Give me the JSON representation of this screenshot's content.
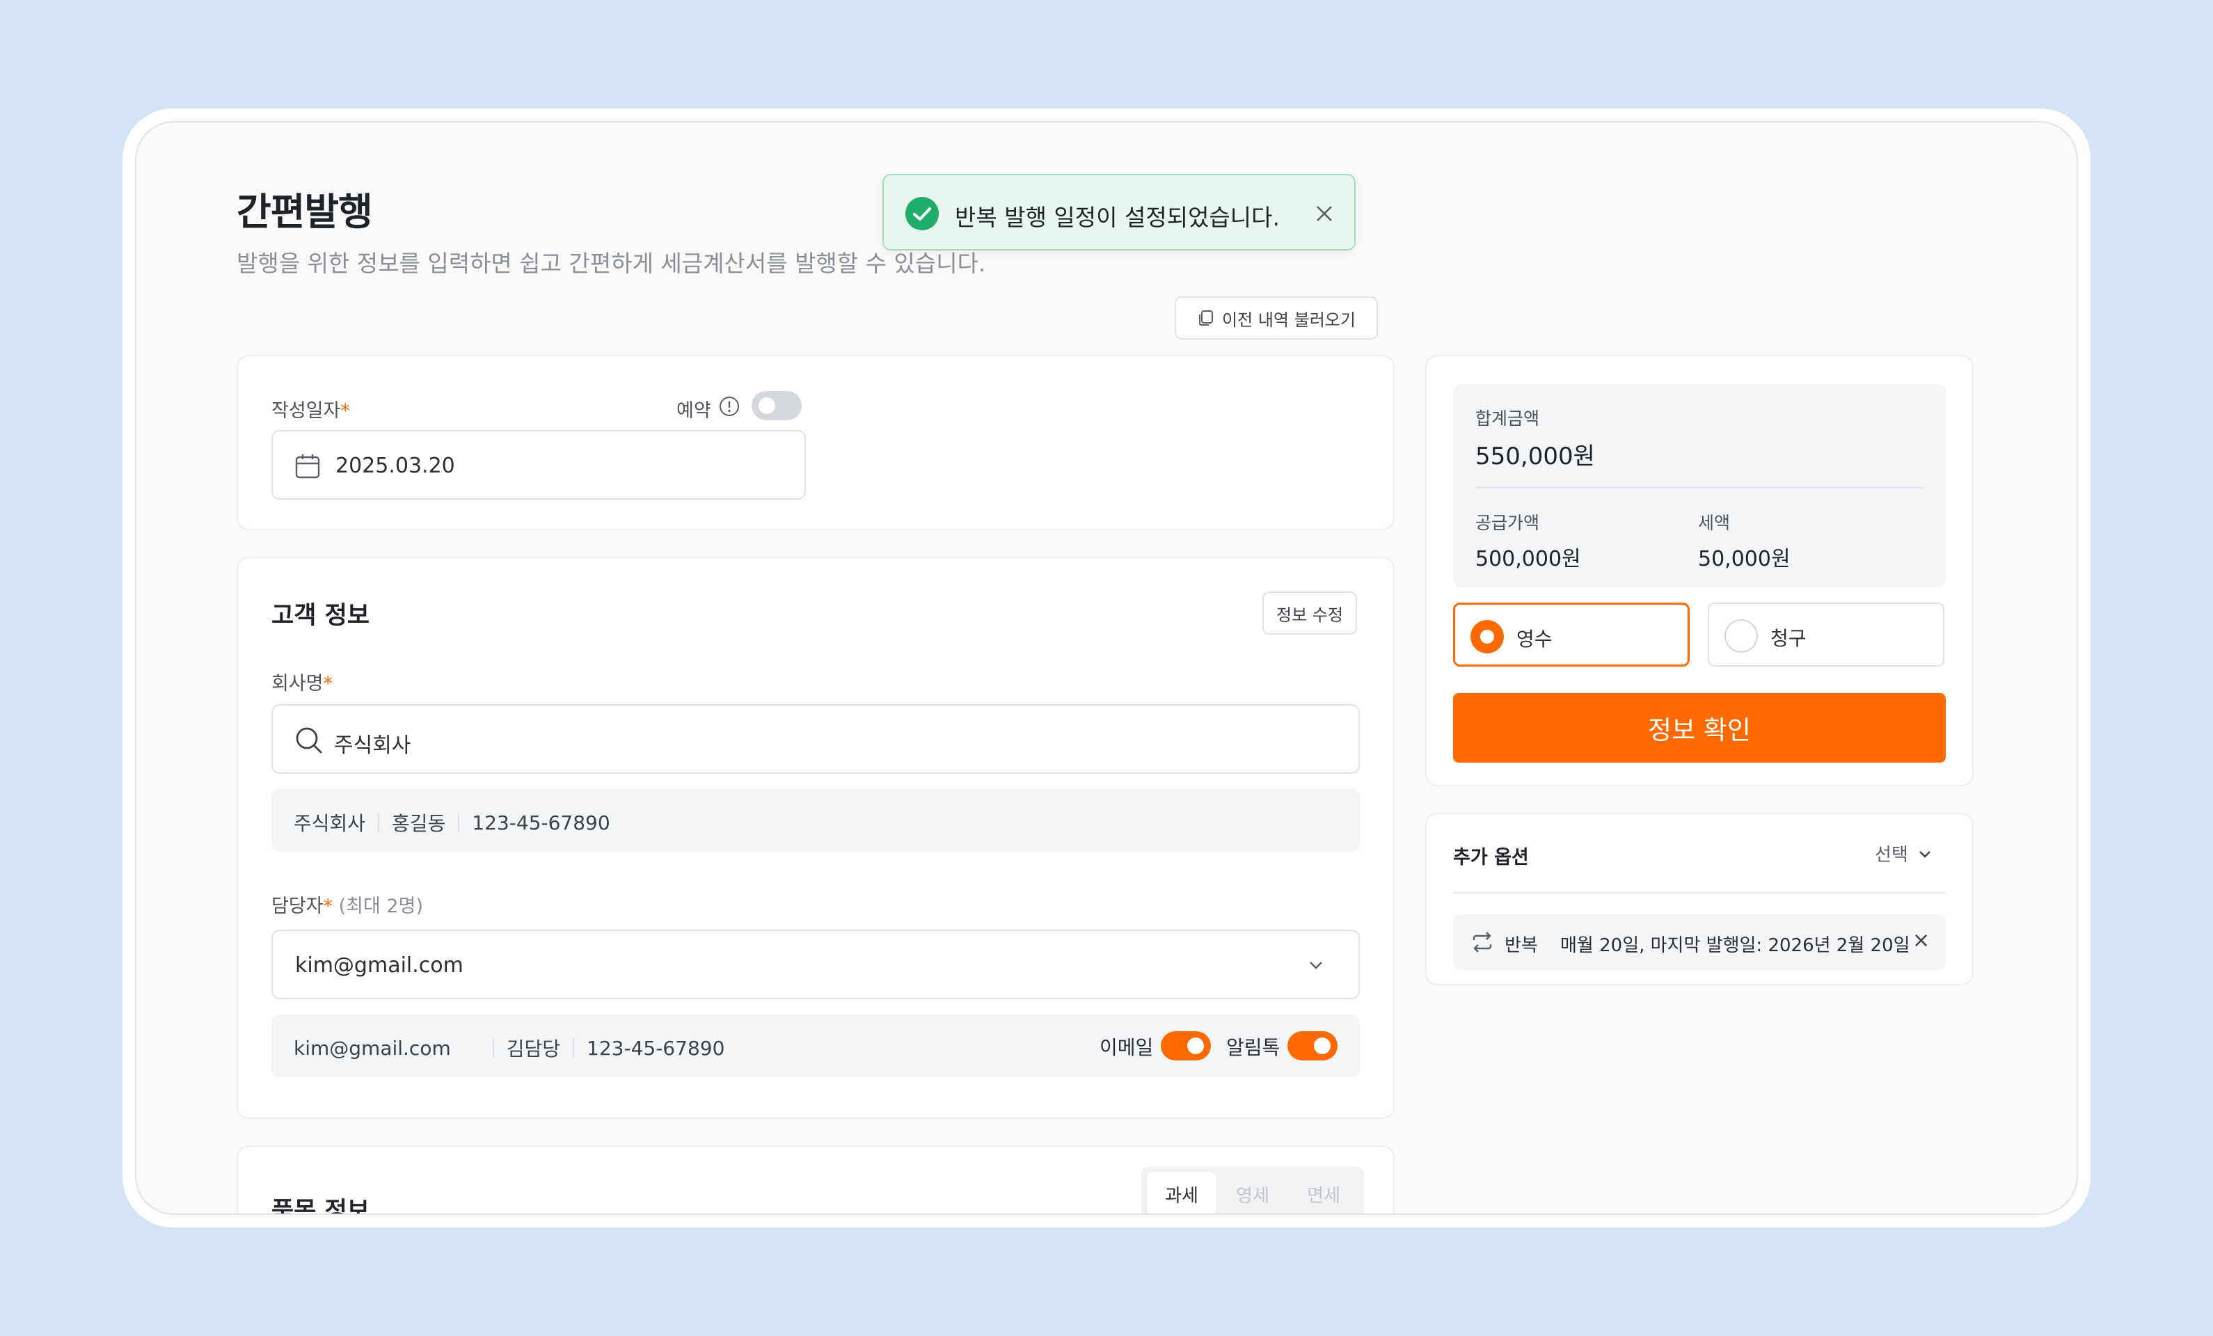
{
  "page": {
    "title": "간편발행",
    "subtitle": "발행을 위한 정보를 입력하면 쉽고 간편하게 세금계산서를 발행할 수 있습니다.",
    "load_history_label": "이전 내역 불러오기"
  },
  "toast": {
    "message": "반복 발행 일정이 설정되었습니다."
  },
  "date_section": {
    "label": "작성일자",
    "required_mark": "*",
    "reserve_label": "예약",
    "reserve_on": false,
    "date_value": "2025.03.20"
  },
  "customer": {
    "title": "고객 정보",
    "edit_label": "정보 수정",
    "company_label": "회사명",
    "required_mark": "*",
    "company_value": "주식회사",
    "summary": {
      "company": "주식회사",
      "representative": "홍길동",
      "business_no": "123-45-67890"
    },
    "manager_label": "담당자",
    "manager_hint": "(최대 2명)",
    "manager_value": "kim@gmail.com",
    "manager_info": {
      "email": "kim@gmail.com",
      "name": "김담당",
      "phone": "123-45-67890",
      "email_toggle_label": "이메일",
      "email_toggle_on": true,
      "alimtalk_toggle_label": "알림톡",
      "alimtalk_toggle_on": true
    }
  },
  "items": {
    "title": "품목 정보",
    "tabs": [
      "과세",
      "영세",
      "면세"
    ],
    "active_tab": "과세"
  },
  "summary": {
    "total_label": "합계금액",
    "total_value": "550,000원",
    "supply_label": "공급가액",
    "supply_value": "500,000원",
    "tax_label": "세액",
    "tax_value": "50,000원",
    "receipt_label": "영수",
    "charge_label": "청구",
    "selected": "영수",
    "confirm_label": "정보 확인"
  },
  "options": {
    "title": "추가 옵션",
    "select_label": "선택",
    "repeat_label": "반복",
    "repeat_detail": "매월 20일, 마지막 발행일: 2026년 2월 20일",
    "remove_symbol": "×"
  },
  "colors": {
    "accent": "#ff6a00",
    "success": "#1fae6a",
    "background": "#d3e4f4"
  }
}
